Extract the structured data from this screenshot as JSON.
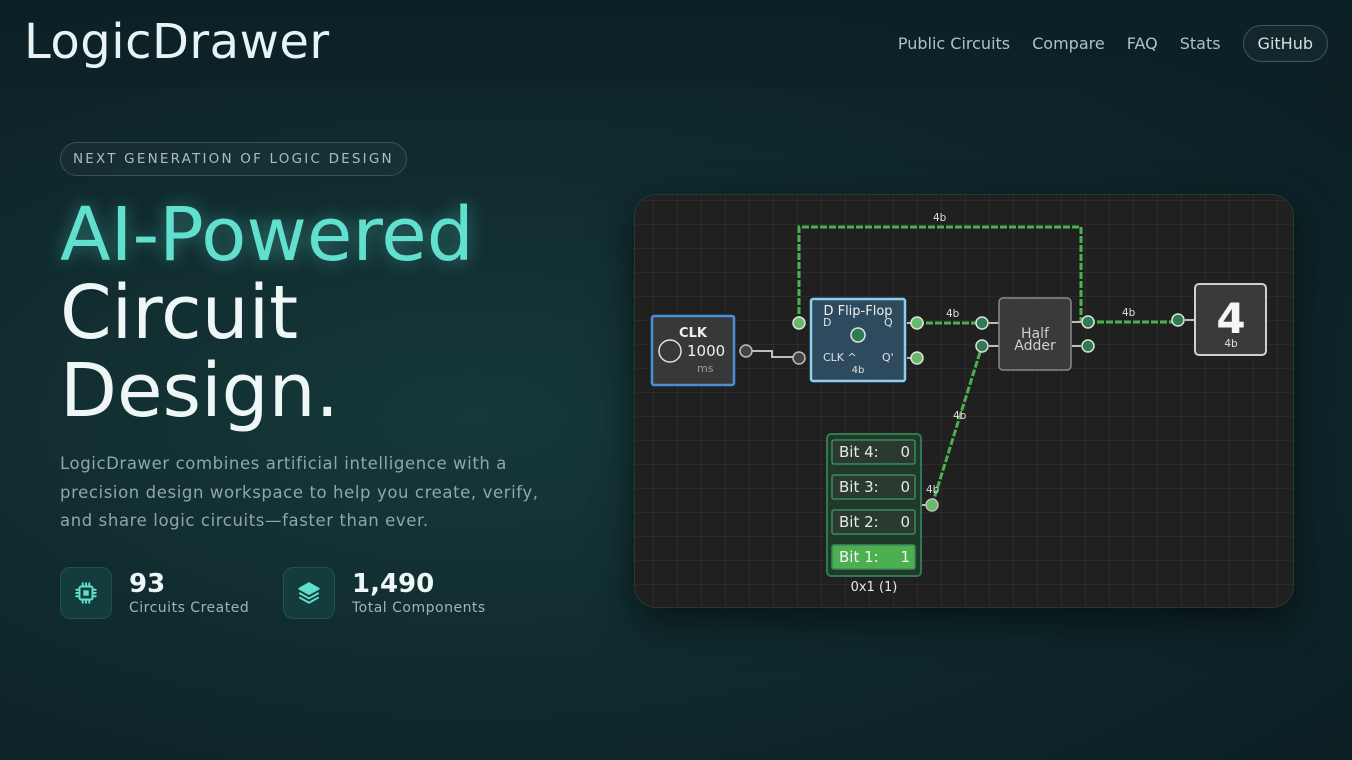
{
  "header": {
    "logo": "LogicDrawer",
    "nav": [
      {
        "label": "Public Circuits"
      },
      {
        "label": "Compare"
      },
      {
        "label": "FAQ"
      },
      {
        "label": "Stats"
      }
    ],
    "github_label": "GitHub"
  },
  "hero": {
    "badge": "NEXT GENERATION OF LOGIC DESIGN",
    "title_accent": "AI-Powered",
    "title_line2": "Circuit",
    "title_line3": "Design.",
    "description": "LogicDrawer combines artificial intelligence with a precision design workspace to help you create, verify, and share logic circuits—faster than ever.",
    "stats": [
      {
        "value": "93",
        "label": "Circuits Created",
        "icon": "chip-icon"
      },
      {
        "value": "1,490",
        "label": "Total Components",
        "icon": "layers-icon"
      }
    ]
  },
  "circuit": {
    "clock": {
      "title": "CLK",
      "value": "1000",
      "unit": "ms"
    },
    "flipflop": {
      "title": "D Flip-Flop",
      "pin_d": "D",
      "pin_q": "Q",
      "pin_clk": "CLK ^",
      "pin_qbar": "Q'",
      "width": "4b"
    },
    "adder": {
      "line1": "Half",
      "line2": "Adder"
    },
    "display": {
      "digit": "4",
      "width": "4b"
    },
    "wire_labels": [
      "4b",
      "4b",
      "4b",
      "4b",
      "4b"
    ],
    "input": {
      "bits": [
        {
          "label": "Bit 4:",
          "value": "0",
          "on": false
        },
        {
          "label": "Bit 3:",
          "value": "0",
          "on": false
        },
        {
          "label": "Bit 2:",
          "value": "0",
          "on": false
        },
        {
          "label": "Bit 1:",
          "value": "1",
          "on": true
        }
      ],
      "readout": "0x1 (1)",
      "port_label": "4b"
    },
    "colors": {
      "wire_active": "#4caf50",
      "wire_idle": "#bdbdbd",
      "clock_border": "#4a90d9",
      "flipflop_border": "#8ecdf0"
    }
  }
}
